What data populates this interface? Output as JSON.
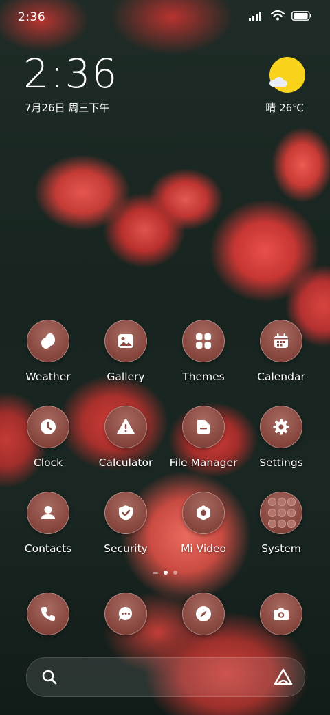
{
  "status_bar": {
    "time": "2:36",
    "icons": [
      "signal-icon",
      "wifi-icon",
      "battery-icon"
    ]
  },
  "lock_widget": {
    "clock": "2:36",
    "date": "7月26日 周三下午",
    "weather": "晴 26℃",
    "weather_icon": "sunny-icon"
  },
  "apps": [
    {
      "label": "Weather",
      "icon": "weather-icon"
    },
    {
      "label": "Gallery",
      "icon": "gallery-icon"
    },
    {
      "label": "Themes",
      "icon": "themes-icon"
    },
    {
      "label": "Calendar",
      "icon": "calendar-icon"
    },
    {
      "label": "Clock",
      "icon": "clock-icon"
    },
    {
      "label": "Calculator",
      "icon": "calculator-icon"
    },
    {
      "label": "File Manager",
      "icon": "folder-icon"
    },
    {
      "label": "Settings",
      "icon": "gear-icon"
    },
    {
      "label": "Contacts",
      "icon": "contacts-icon"
    },
    {
      "label": "Security",
      "icon": "shield-icon"
    },
    {
      "label": "Mi Video",
      "icon": "video-icon"
    },
    {
      "label": "System",
      "icon": "folder-grid-icon"
    }
  ],
  "dock": [
    {
      "name": "phone",
      "icon": "phone-icon"
    },
    {
      "name": "messages",
      "icon": "message-icon"
    },
    {
      "name": "browser",
      "icon": "compass-icon"
    },
    {
      "name": "camera",
      "icon": "camera-icon"
    }
  ],
  "page_indicator": {
    "pages": 2,
    "current": 1
  },
  "search_bar": {
    "left_icon": "search-icon",
    "right_icon": "assistant-icon"
  },
  "colors": {
    "icon_bg": "#8a4a42",
    "sun": "#f9d21c",
    "background": "#1a2622"
  }
}
